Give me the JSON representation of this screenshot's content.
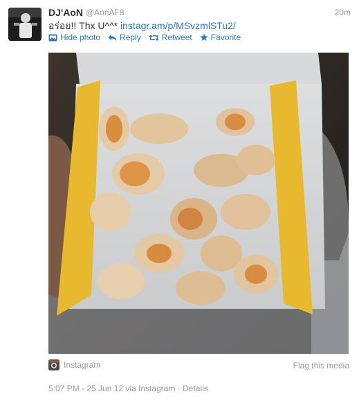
{
  "user": {
    "display_name": "DJ'AoN",
    "handle": "@AonAF8"
  },
  "tweet": {
    "timestamp": "20m",
    "text_prefix": "อร่อย!! Thx U^^* ",
    "link": "instagr.am/p/MSvzmlSTu2/"
  },
  "actions": {
    "hide_photo": "Hide photo",
    "reply": "Reply",
    "retweet": "Retweet",
    "favorite": "Favorite"
  },
  "media": {
    "source": "Instagram",
    "flag": "Flag this media"
  },
  "footer": {
    "meta": "5:07 PM - 25 Jun 12 via Instagram · Details"
  },
  "colors": {
    "link": "#2b7bb9",
    "muted": "#999999",
    "text": "#333333"
  }
}
